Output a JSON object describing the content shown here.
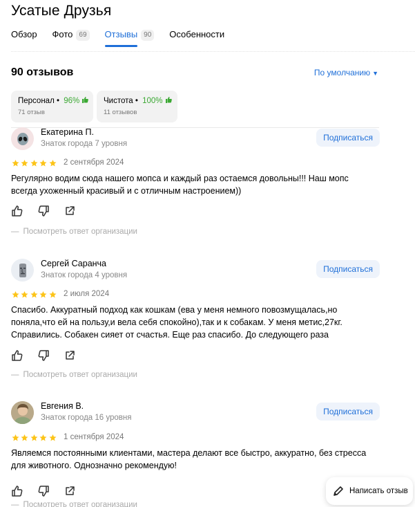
{
  "page": {
    "title": "Усатые Друзья"
  },
  "tabs": [
    {
      "label": "Обзор",
      "count": ""
    },
    {
      "label": "Фото",
      "count": "69"
    },
    {
      "label": "Отзывы",
      "count": "90"
    },
    {
      "label": "Особенности",
      "count": ""
    }
  ],
  "reviews_header": {
    "count_label": "90 отзывов",
    "sort_label": "По умолчанию"
  },
  "aspects": [
    {
      "name": "Персонал",
      "percent": "96%",
      "count": "71 отзыв"
    },
    {
      "name": "Чистота",
      "percent": "100%",
      "count": "11 отзывов"
    }
  ],
  "colors": {
    "accent": "#1f6fd8",
    "positive": "#3ba833",
    "star": "#fcc419"
  },
  "reviews": [
    {
      "author": "Екатерина П.",
      "level": "Знаток города 7 уровня",
      "subscribe": "Подписаться",
      "rating": 5,
      "date": "2 сентября 2024",
      "text": "Регулярно водим сюда нашего мопса и каждый раз остаемся довольны!!! Наш мопс всегда ухоженный красивый и с отличным настроением))",
      "answer_link": "Посмотреть ответ организации",
      "avatar_icon": "alien-icon"
    },
    {
      "author": "Сергей Саранча",
      "level": "Знаток города 4 уровня",
      "subscribe": "Подписаться",
      "rating": 5,
      "date": "2 июля 2024",
      "text": "Спасибо. Аккуратный подход как кошкам (ева у меня немного повозмущалась,но поняла,что ей на пользу,и вела себя спокойно),так и к собакам. У меня метис,27кг. Справились. Собакен сияет от счастья. Еще раз спасибо. До следующего раза",
      "answer_link": "Посмотреть ответ организации",
      "avatar_icon": "moai-icon"
    },
    {
      "author": "Евгения В.",
      "level": "Знаток города 16 уровня",
      "subscribe": "Подписаться",
      "rating": 5,
      "date": "1 сентября 2024",
      "text": "Являемся постоянными клиентами, мастера делают все быстро, аккуратно, без стресса для животного. Однозначно рекомендую!",
      "answer_link": "Посмотреть ответ организации",
      "avatar_icon": "user-photo"
    }
  ],
  "write_review": {
    "label": "Написать отзыв"
  }
}
